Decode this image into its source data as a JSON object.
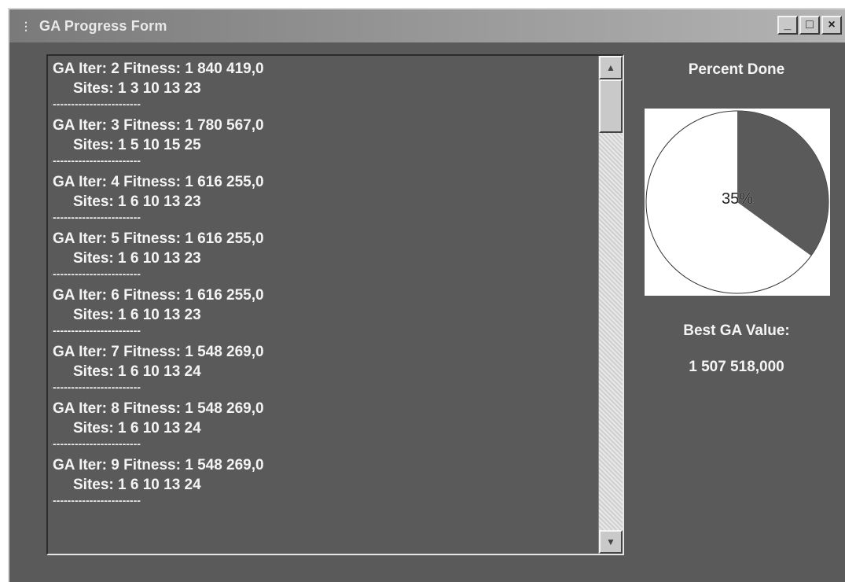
{
  "window": {
    "title": "GA Progress Form",
    "buttons": {
      "minimize": "_",
      "maximize": "□",
      "close": "×"
    }
  },
  "log": {
    "separator": "------------------------",
    "entries": [
      {
        "line1": "GA Iter: 2 Fitness: 1 840 419,0",
        "line2": "Sites: 1 3 10 13 23"
      },
      {
        "line1": "GA Iter: 3 Fitness: 1 780 567,0",
        "line2": "Sites: 1 5 10 15 25"
      },
      {
        "line1": "GA Iter: 4 Fitness: 1 616 255,0",
        "line2": "Sites: 1 6 10 13 23"
      },
      {
        "line1": "GA Iter: 5 Fitness: 1 616 255,0",
        "line2": "Sites: 1 6 10 13 23"
      },
      {
        "line1": "GA Iter: 6 Fitness: 1 616 255,0",
        "line2": "Sites: 1 6 10 13 23"
      },
      {
        "line1": "GA Iter: 7 Fitness: 1 548 269,0",
        "line2": "Sites: 1 6 10 13 24"
      },
      {
        "line1": "GA Iter: 8 Fitness: 1 548 269,0",
        "line2": "Sites: 1 6 10 13 24"
      },
      {
        "line1": "GA Iter: 9 Fitness: 1 548 269,0",
        "line2": "Sites: 1 6 10 13 24"
      }
    ]
  },
  "progress": {
    "label": "Percent Done",
    "percent_text": "35%",
    "fraction": 0.35,
    "filled_color": "#5a5a5a",
    "empty_color": "#ffffff"
  },
  "best": {
    "label": "Best GA Value:",
    "value": "1 507 518,000"
  }
}
